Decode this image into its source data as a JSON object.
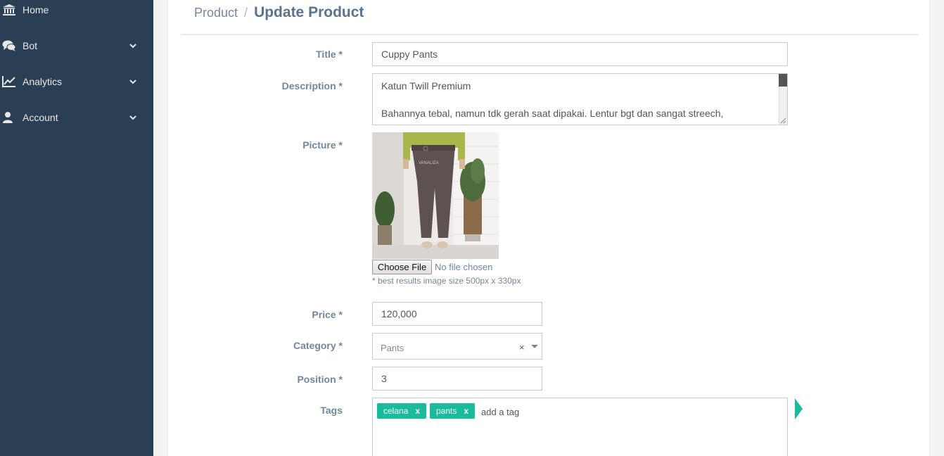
{
  "sidebar": {
    "items": [
      {
        "label": "Home",
        "icon": "bank-icon",
        "has_submenu": false
      },
      {
        "label": "Bot",
        "icon": "comments-icon",
        "has_submenu": true
      },
      {
        "label": "Analytics",
        "icon": "line-chart-icon",
        "has_submenu": true
      },
      {
        "label": "Account",
        "icon": "user-icon",
        "has_submenu": true
      }
    ]
  },
  "breadcrumb": {
    "parent": "Product",
    "separator": "/",
    "current": "Update Product"
  },
  "form": {
    "title": {
      "label": "Title *",
      "value": "Cuppy Pants"
    },
    "description": {
      "label": "Description *",
      "line1": "Katun Twill Premium",
      "line2": "Bahannya tebal, namun tdk gerah saat dipakai. Lentur bgt dan sangat streech,"
    },
    "picture": {
      "label": "Picture *",
      "choose_button": "Choose File",
      "file_status": "No file chosen",
      "hint": "* best results image size 500px x 330px",
      "watermark": "VANALIZA"
    },
    "price": {
      "label": "Price *",
      "value": "120,000"
    },
    "category": {
      "label": "Category *",
      "value": "Pants",
      "clear": "×"
    },
    "position": {
      "label": "Position *",
      "value": "3"
    },
    "tags": {
      "label": "Tags",
      "items": [
        {
          "text": "celana",
          "remove": "x"
        },
        {
          "text": "pants",
          "remove": "x"
        }
      ],
      "placeholder": "add a tag"
    }
  },
  "colors": {
    "sidebar_bg": "#2a3f54",
    "accent": "#1abb9c",
    "label": "#73879c",
    "heading": "#5a738e"
  }
}
